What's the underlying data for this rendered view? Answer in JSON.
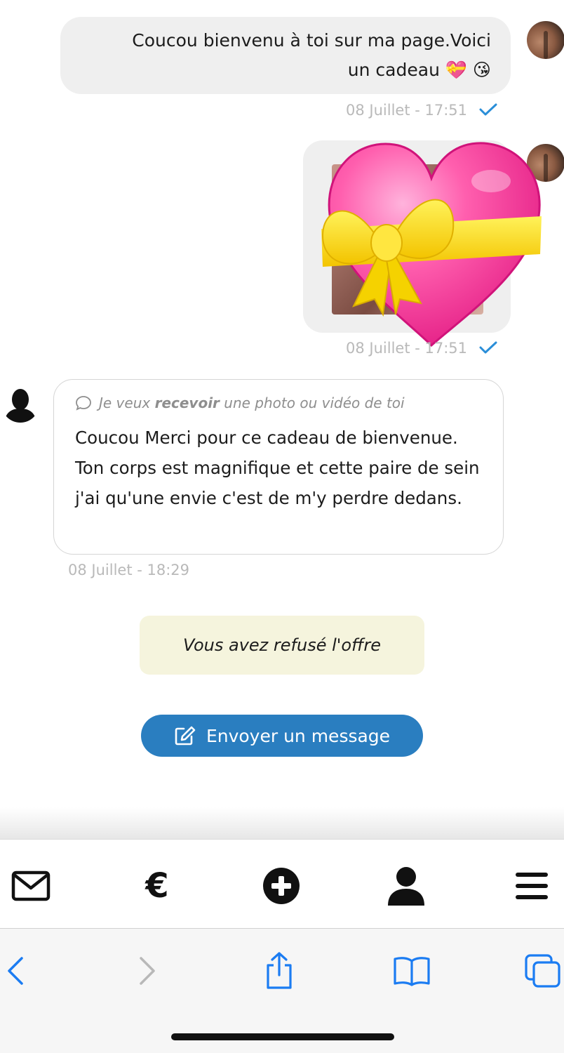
{
  "messages": {
    "outgoing_text": {
      "line1": "Coucou bienvenu à toi sur ma page.Voici",
      "line2": "un cadeau 💝 😘",
      "timestamp": "08 Juillet - 17:51"
    },
    "outgoing_photo": {
      "timestamp": "08 Juillet - 17:51"
    },
    "incoming": {
      "request_prefix": "Je veux ",
      "request_bold": "recevoir",
      "request_suffix": " une photo ou vidéo de toi",
      "text": "Coucou Merci pour ce cadeau de bienvenue. Ton corps est magnifique et cette paire de sein j'ai qu'une envie c'est de m'y perdre dedans.",
      "timestamp": "08 Juillet - 18:29"
    }
  },
  "notice": {
    "text": "Vous avez refusé l'offre"
  },
  "send_button": {
    "label": "Envoyer un message",
    "icon": "edit-icon"
  },
  "tabbar": [
    {
      "name": "messages",
      "icon": "envelope-icon"
    },
    {
      "name": "payments",
      "icon": "euro-icon",
      "glyph": "€"
    },
    {
      "name": "create",
      "icon": "plus-circle-icon"
    },
    {
      "name": "profile",
      "icon": "user-icon"
    },
    {
      "name": "menu",
      "icon": "hamburger-icon"
    }
  ],
  "browser_toolbar": [
    {
      "name": "back",
      "icon": "chevron-left-icon",
      "enabled": true
    },
    {
      "name": "forward",
      "icon": "chevron-right-icon",
      "enabled": false
    },
    {
      "name": "share",
      "icon": "share-icon"
    },
    {
      "name": "bookmarks",
      "icon": "book-icon"
    },
    {
      "name": "tabs",
      "icon": "tabs-icon"
    }
  ],
  "colors": {
    "accent": "#2a7ec0",
    "bubble_out": "#efefef",
    "notice_bg": "#f5f4dd",
    "timestamp": "#b9b9b9",
    "check": "#2a8ed8",
    "ios_blue": "#1b7cf2"
  }
}
